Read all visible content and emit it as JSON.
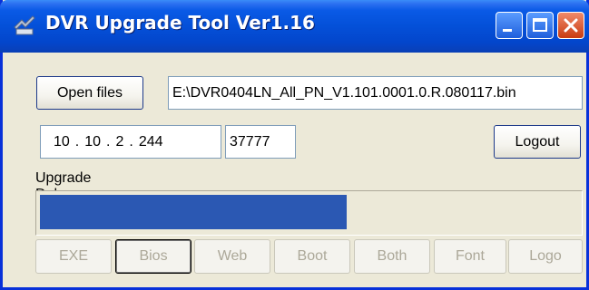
{
  "window": {
    "title": "DVR Upgrade Tool Ver1.16",
    "icon": "dvr-upgrade-icon",
    "controls": [
      "minimize-icon",
      "maximize-icon",
      "close-icon"
    ]
  },
  "file": {
    "open_label": "Open files",
    "path": "E:\\DVR0404LN_All_PN_V1.101.0001.0.R.080117.bin"
  },
  "connection": {
    "ip": [
      "10",
      "10",
      "2",
      "244"
    ],
    "port": "37777",
    "logout_label": "Logout"
  },
  "status": {
    "text": "Upgrade Debug BIOS program...",
    "progress_percent": 57
  },
  "modes": [
    {
      "label": "EXE",
      "enabled": false
    },
    {
      "label": "Bios",
      "enabled": false,
      "focused": true
    },
    {
      "label": "Web",
      "enabled": false
    },
    {
      "label": "Boot",
      "enabled": false
    },
    {
      "label": "Both",
      "enabled": false
    },
    {
      "label": "Font",
      "enabled": false
    },
    {
      "label": "Logo",
      "enabled": false
    }
  ],
  "colors": {
    "titlebar": "#0450d8",
    "progress": "#2b58b3",
    "face": "#ece9d8"
  }
}
